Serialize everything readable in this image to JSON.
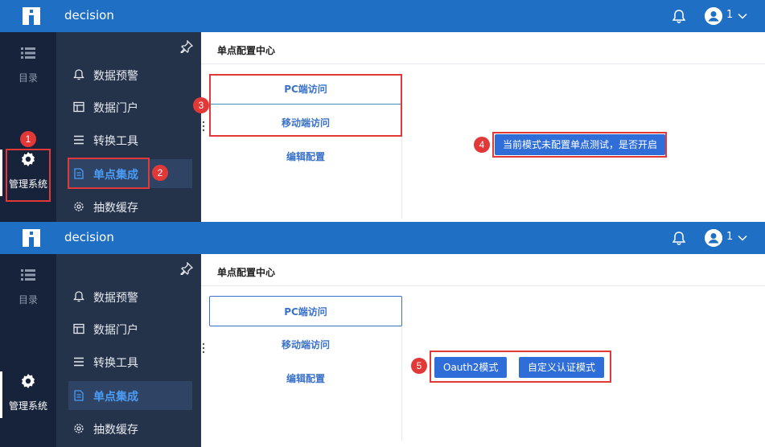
{
  "colors": {
    "topbar": "#1f6fc5",
    "rail": "#17233a",
    "menu": "#24324a",
    "active_menu_text": "#4b9cf5",
    "primary_button": "#2f6ed8",
    "annotation": "#e33838"
  },
  "panel1": {
    "app_title": "decision",
    "user_name": "1",
    "rail": [
      {
        "label": "目录",
        "icon": "list-icon"
      },
      {
        "label": "管理系统",
        "icon": "gear-icon"
      }
    ],
    "menu": [
      {
        "label": "数据预警",
        "icon": "bell-icon"
      },
      {
        "label": "数据门户",
        "icon": "portal-icon"
      },
      {
        "label": "转换工具",
        "icon": "list-lines-icon"
      },
      {
        "label": "单点集成",
        "icon": "document-icon"
      },
      {
        "label": "抽数缓存",
        "icon": "gear-small-icon"
      }
    ],
    "page_title": "单点配置中心",
    "sso_tabs": [
      "PC端访问",
      "移动端访问",
      "编辑配置"
    ],
    "notice_button": "当前模式未配置单点测试，是否开启",
    "markers": [
      "1",
      "2",
      "3",
      "4"
    ]
  },
  "panel2": {
    "app_title": "decision",
    "user_name": "1",
    "rail": [
      {
        "label": "目录",
        "icon": "list-icon"
      },
      {
        "label": "管理系统",
        "icon": "gear-icon"
      }
    ],
    "menu": [
      {
        "label": "数据预警",
        "icon": "bell-icon"
      },
      {
        "label": "数据门户",
        "icon": "portal-icon"
      },
      {
        "label": "转换工具",
        "icon": "list-lines-icon"
      },
      {
        "label": "单点集成",
        "icon": "document-icon"
      },
      {
        "label": "抽数缓存",
        "icon": "gear-small-icon"
      }
    ],
    "page_title": "单点配置中心",
    "sso_tabs": [
      "PC端访问",
      "移动端访问",
      "编辑配置"
    ],
    "mode_buttons": [
      "Oauth2模式",
      "自定义认证模式"
    ],
    "markers": [
      "5"
    ]
  }
}
